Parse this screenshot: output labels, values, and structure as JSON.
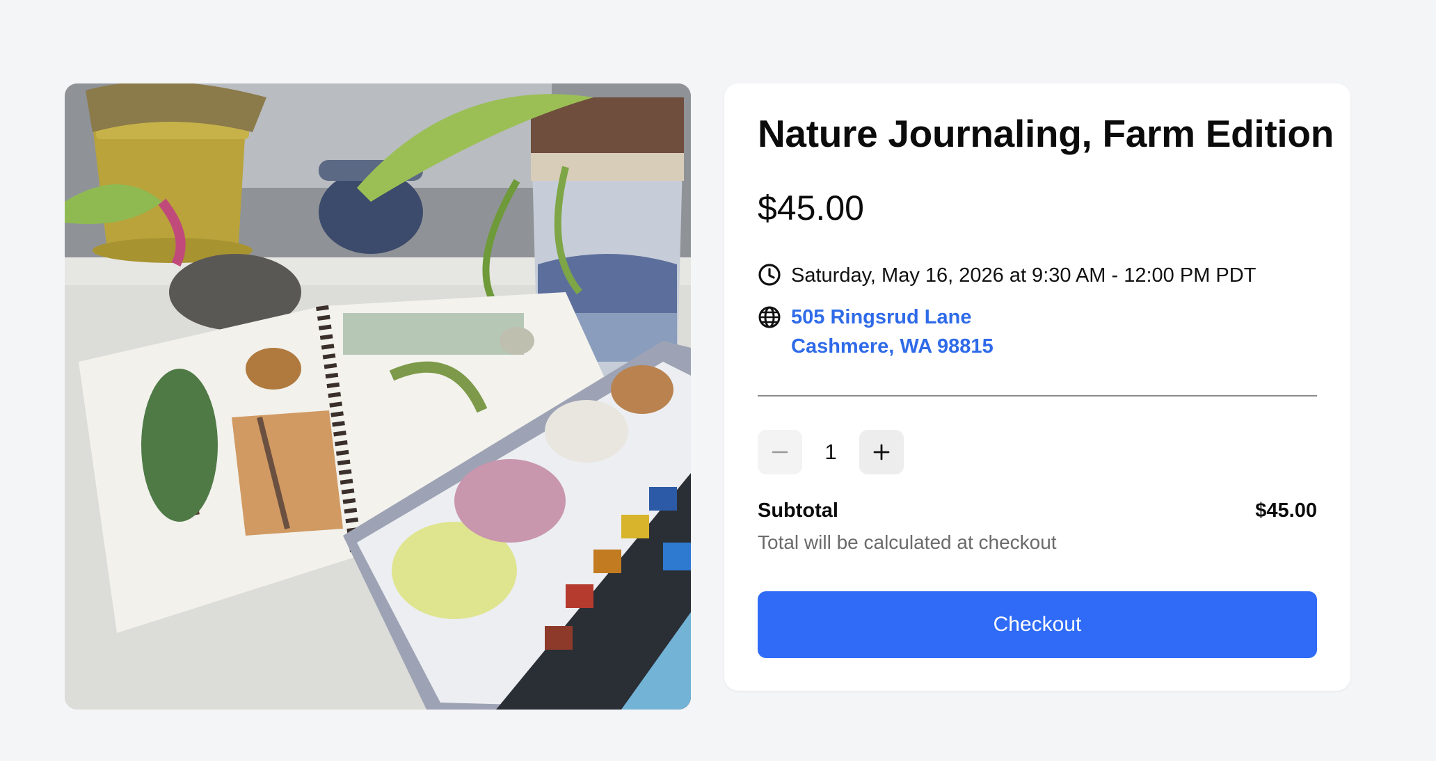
{
  "product": {
    "title": "Nature Journaling, Farm Edition",
    "price": "$45.00",
    "image_icon": "product-photo",
    "datetime": "Saturday, May 16, 2026 at 9:30 AM - 12:00 PM PDT",
    "address_line1": "505 Ringsrud Lane",
    "address_line2": "Cashmere, WA 98815"
  },
  "icons": {
    "time": "clock-icon",
    "location": "globe-icon",
    "decrease": "minus-icon",
    "increase": "plus-icon"
  },
  "cart": {
    "quantity": "1",
    "subtotal_label": "Subtotal",
    "subtotal_value": "$45.00",
    "note": "Total will be calculated at checkout",
    "checkout_label": "Checkout"
  },
  "colors": {
    "background": "#f4f5f7",
    "card": "#ffffff",
    "accent": "#2f6bf6",
    "link": "#2f6be8",
    "muted_text": "#6b6b6b"
  }
}
